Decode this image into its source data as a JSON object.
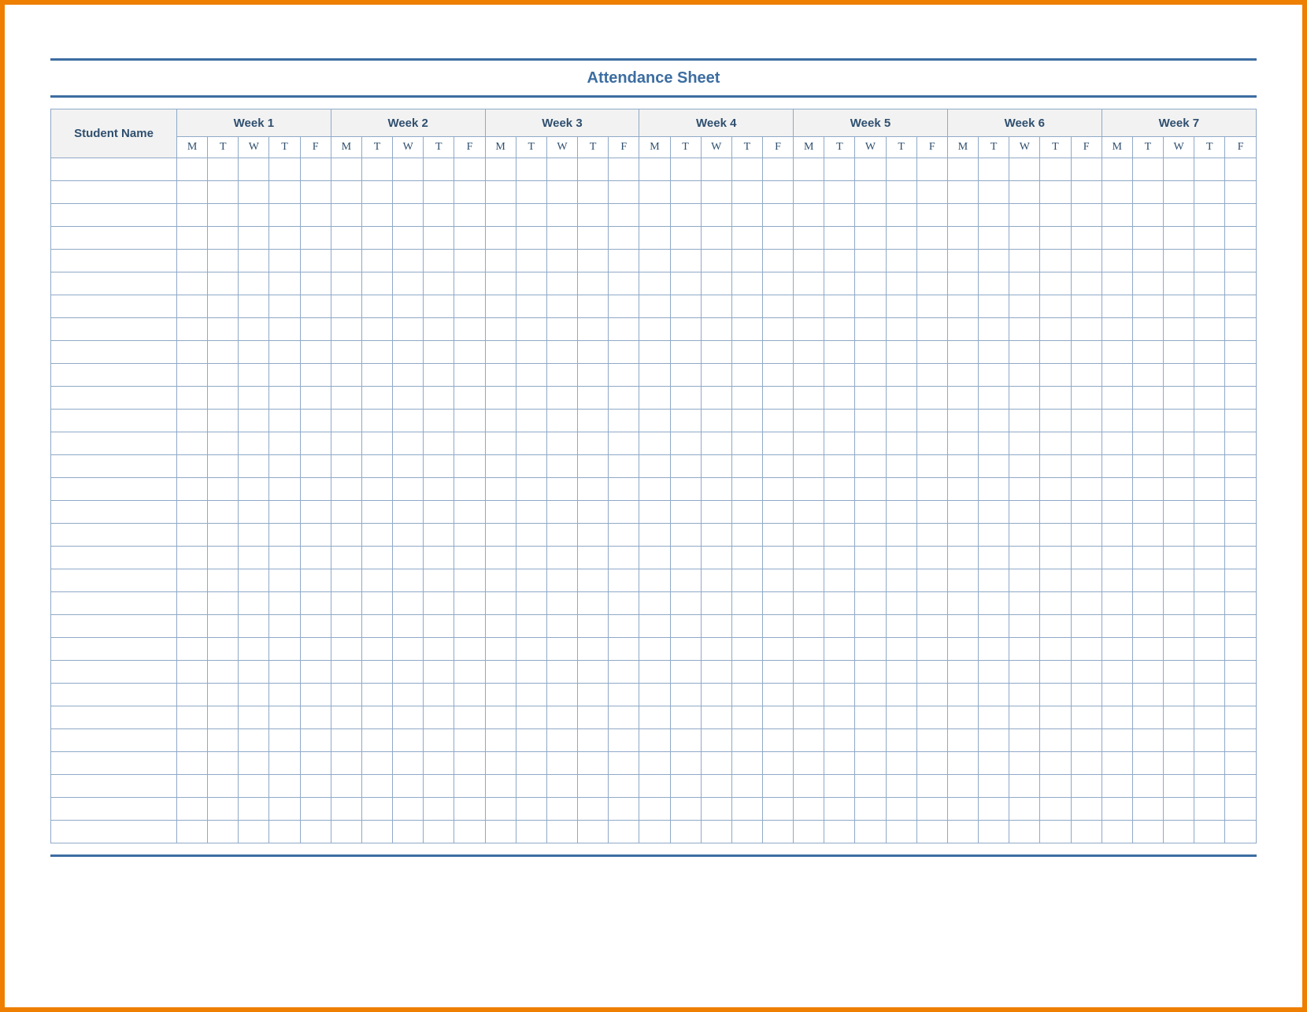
{
  "title": "Attendance Sheet",
  "columns": {
    "name_header": "Student Name",
    "weeks": [
      "Week 1",
      "Week 2",
      "Week 3",
      "Week 4",
      "Week 5",
      "Week 6",
      "Week 7"
    ],
    "days": [
      "M",
      "T",
      "W",
      "T",
      "F"
    ]
  },
  "row_count": 30,
  "colors": {
    "frame": "#EE7F00",
    "accent": "#3C6DA1",
    "grid": "#8FA9C7",
    "header_bg": "#F2F2F2"
  }
}
